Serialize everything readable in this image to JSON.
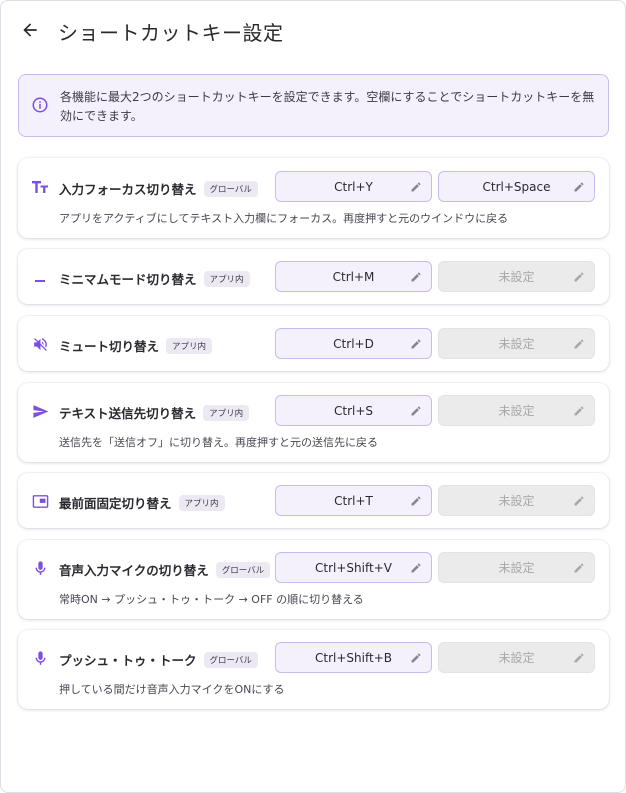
{
  "header": {
    "title": "ショートカットキー設定"
  },
  "info": {
    "text": "各機能に最大2つのショートカットキーを設定できます。空欄にすることでショートカットキーを無効にできます。"
  },
  "rows": [
    {
      "label": "入力フォーカス切り替え",
      "scope": "グローバル",
      "icon": "text-size-icon",
      "key1": "Ctrl+Y",
      "key2": "Ctrl+Space",
      "description": "アプリをアクティブにしてテキスト入力欄にフォーカス。再度押すと元のウインドウに戻る"
    },
    {
      "label": "ミニマムモード切り替え",
      "scope": "アプリ内",
      "icon": "minimize-icon",
      "key1": "Ctrl+M",
      "key2": "未設定",
      "description": ""
    },
    {
      "label": "ミュート切り替え",
      "scope": "アプリ内",
      "icon": "volume-off-icon",
      "key1": "Ctrl+D",
      "key2": "未設定",
      "description": ""
    },
    {
      "label": "テキスト送信先切り替え",
      "scope": "アプリ内",
      "icon": "send-icon",
      "key1": "Ctrl+S",
      "key2": "未設定",
      "description": "送信先を「送信オフ」に切り替え。再度押すと元の送信先に戻る"
    },
    {
      "label": "最前面固定切り替え",
      "scope": "アプリ内",
      "icon": "picture-in-picture-icon",
      "key1": "Ctrl+T",
      "key2": "未設定",
      "description": ""
    },
    {
      "label": "音声入力マイクの切り替え",
      "scope": "グローバル",
      "icon": "microphone-icon",
      "key1": "Ctrl+Shift+V",
      "key2": "未設定",
      "description": "常時ON → プッシュ・トゥ・トーク → OFF の順に切り替える"
    },
    {
      "label": "プッシュ・トゥ・トーク",
      "scope": "グローバル",
      "icon": "microphone-icon",
      "key1": "Ctrl+Shift+B",
      "key2": "未設定",
      "description": "押している間だけ音声入力マイクをONにする"
    }
  ],
  "colors": {
    "accent": "#7b4fe0",
    "set_field_bg": "#f4f0fc",
    "set_field_border": "#c9bbee",
    "unset_field_bg": "#ebebeb",
    "unset_text": "#a8a8a8"
  }
}
